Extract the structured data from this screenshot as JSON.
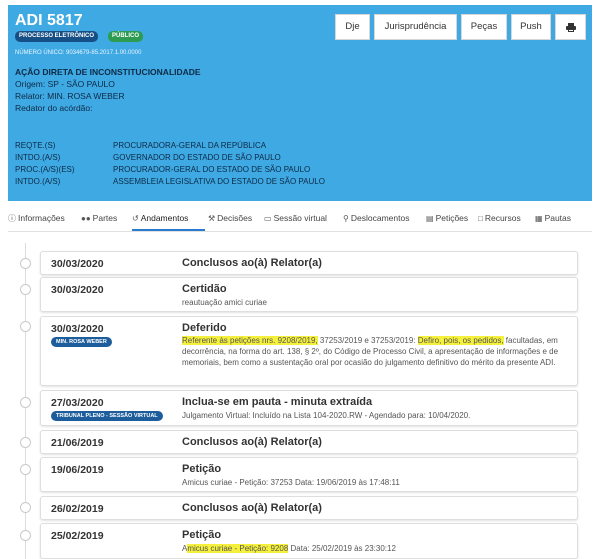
{
  "header": {
    "process_title": "ADI 5817",
    "badge_eletronico": "PROCESSO ELETRÔNICO",
    "badge_publico": "PÚBLICO",
    "numero_unico": "NÚMERO ÚNICO: 9034679-85.2017.1.00.0000",
    "classe": "AÇÃO DIRETA DE INCONSTITUCIONALIDADE",
    "origem": "Origem: SP - SÃO PAULO",
    "relator": "Relator: MIN. ROSA WEBER",
    "redator": "Redator do acórdão:",
    "buttons": {
      "dje": "Dje",
      "jurisprudencia": "Jurisprudência",
      "pecas": "Peças",
      "push": "Push"
    },
    "parties": [
      {
        "role": "REQTE.(S)",
        "name": "PROCURADORA-GERAL DA REPÚBLICA"
      },
      {
        "role": "INTDO.(A/S)",
        "name": "GOVERNADOR DO ESTADO DE SÃO PAULO"
      },
      {
        "role": "PROC.(A/S)(ES)",
        "name": "PROCURADOR-GERAL DO ESTADO DE SÃO PAULO"
      },
      {
        "role": "INTDO.(A/S)",
        "name": "ASSEMBLEIA LEGISLATIVA DO ESTADO DE SÃO PAULO"
      }
    ]
  },
  "tabs": [
    {
      "label": "Informações",
      "icon": "info-icon"
    },
    {
      "label": "Partes",
      "icon": "users-icon"
    },
    {
      "label": "Andamentos",
      "icon": "history-icon",
      "active": true
    },
    {
      "label": "Decisões",
      "icon": "gavel-icon"
    },
    {
      "label": "Sessão virtual",
      "icon": "monitor-icon"
    },
    {
      "label": "Deslocamentos",
      "icon": "map-marker-icon"
    },
    {
      "label": "Petições",
      "icon": "document-icon"
    },
    {
      "label": "Recursos",
      "icon": "file-icon"
    },
    {
      "label": "Pautas",
      "icon": "calendar-icon"
    }
  ],
  "andamentos": [
    {
      "date": "30/03/2020",
      "title": "Conclusos ao(à) Relator(a)"
    },
    {
      "date": "30/03/2020",
      "title": "Certidão",
      "text": "reautuação amici curiae"
    },
    {
      "date": "30/03/2020",
      "badge": "MIN. ROSA WEBER",
      "title": "Deferido",
      "text_parts": {
        "hl1": "Referente às petições nrs. 9208/2019,",
        "mid": " 37253/2019 e 37253/2019: ",
        "hl2": "Defiro, pois, os pedidos,",
        "rest": " facultadas, em decorrência, na forma do art. 138, § 2º, do Código de Processo Civil, a apresentação de informações e de memoriais, bem como a sustentação oral por ocasião do julgamento definitivo do mérito da presente ADI."
      }
    },
    {
      "date": "27/03/2020",
      "badge": "TRIBUNAL PLENO - SESSÃO VIRTUAL",
      "title": "Inclua-se em pauta - minuta extraída",
      "text": "Julgamento Virtual: Incluído na Lista 104-2020.RW - Agendado para: 10/04/2020."
    },
    {
      "date": "21/06/2019",
      "title": "Conclusos ao(à) Relator(a)"
    },
    {
      "date": "19/06/2019",
      "title": "Petição",
      "text": "Amicus curiae - Petição: 37253 Data: 19/06/2019 às 17:48:11"
    },
    {
      "date": "26/02/2019",
      "title": "Conclusos ao(à) Relator(a)"
    },
    {
      "date": "25/02/2019",
      "title": "Petição",
      "text_parts": {
        "pre": "A",
        "hl": "micus curiae - Petição: 9208",
        "post": " Data: 25/02/2019 às 23:30:12"
      }
    }
  ],
  "colors": {
    "header_bg": "#3fa9e4",
    "badge_eletronico": "#164f86",
    "badge_publico": "#2e9b52",
    "highlight": "#f5f03b",
    "tab_active_underline": "#2a7ad0"
  }
}
